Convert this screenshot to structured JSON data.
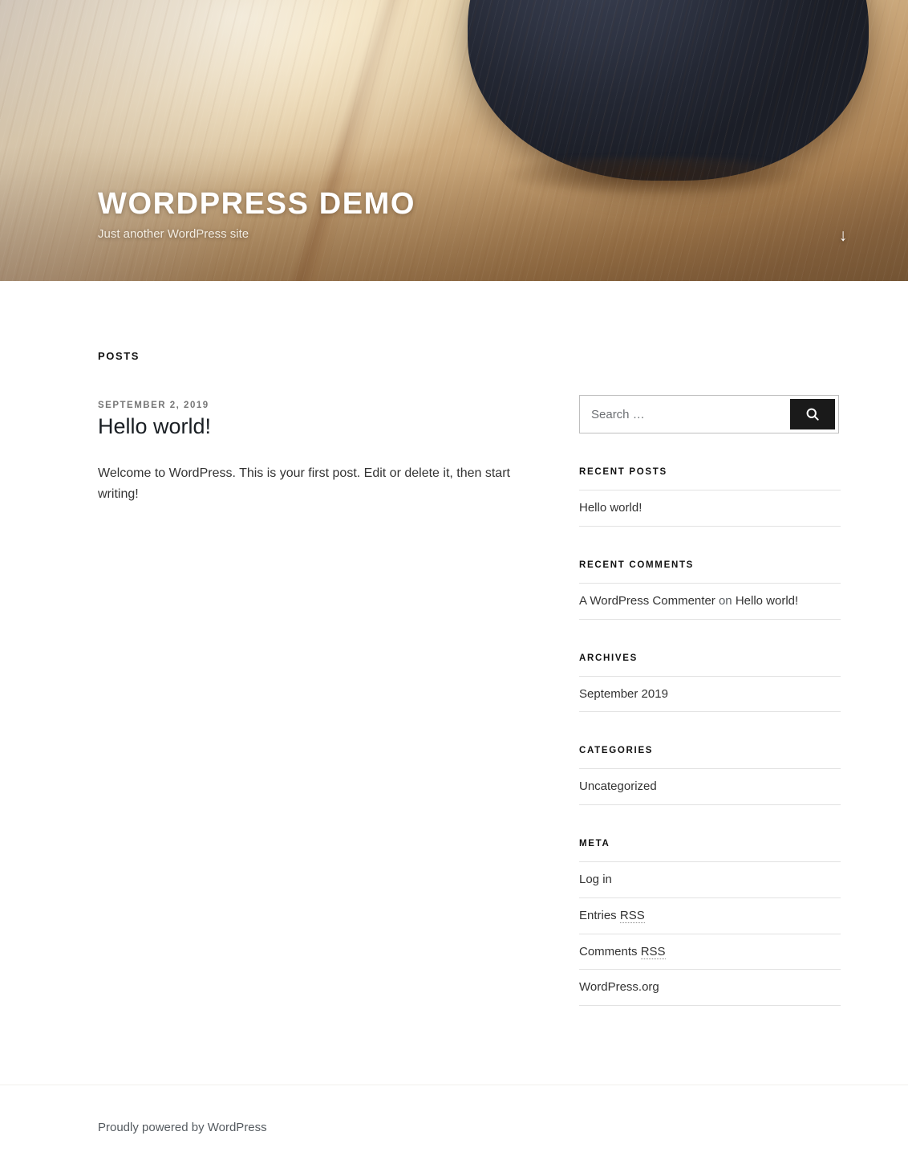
{
  "header": {
    "site_title": "WORDPRESS DEMO",
    "site_description": "Just another WordPress site",
    "scroll_down_icon": "arrow-down-icon",
    "scroll_down_glyph": "↓"
  },
  "main": {
    "page_title": "POSTS",
    "posts": [
      {
        "date": "SEPTEMBER 2, 2019",
        "title": "Hello world!",
        "excerpt": "Welcome to WordPress. This is your first post. Edit or delete it, then start writing!"
      }
    ]
  },
  "sidebar": {
    "search": {
      "placeholder": "Search …",
      "value": "",
      "submit_icon": "search-icon",
      "submit_label": "Search"
    },
    "widgets": [
      {
        "title": "RECENT POSTS",
        "items": [
          "Hello world!"
        ]
      },
      {
        "title": "RECENT COMMENTS",
        "comment_author": "A WordPress Commenter",
        "comment_connector": " on ",
        "comment_post": "Hello world!"
      },
      {
        "title": "ARCHIVES",
        "items": [
          "September 2019"
        ]
      },
      {
        "title": "CATEGORIES",
        "items": [
          "Uncategorized"
        ]
      },
      {
        "title": "META",
        "items": [
          "Log in",
          "Entries RSS",
          "Comments RSS",
          "WordPress.org"
        ],
        "meta_links": [
          {
            "text": "Log in",
            "abbr": ""
          },
          {
            "prefix": "Entries ",
            "abbr": "RSS"
          },
          {
            "prefix": "Comments ",
            "abbr": "RSS"
          },
          {
            "text": "WordPress.org",
            "abbr": ""
          }
        ]
      }
    ]
  },
  "footer": {
    "credit": "Proudly powered by WordPress"
  },
  "colors": {
    "accent_dark": "#1a1a1a",
    "text": "#333333",
    "muted": "#767676",
    "rule": "#e2e2e2"
  }
}
